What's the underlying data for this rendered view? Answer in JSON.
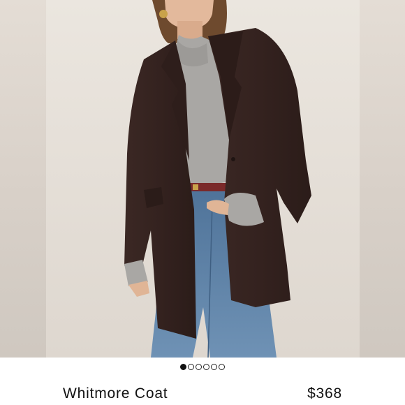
{
  "product": {
    "name": "Whitmore Coat",
    "price": "$368"
  },
  "gallery": {
    "image_count": 6,
    "active_index": 0
  },
  "colors": {
    "background": "#ffffff",
    "photo_backdrop": "#e7e1da",
    "coat": "#3a2622",
    "sweater": "#a8a6a3",
    "jeans": "#5a7fa6",
    "text": "#111111"
  }
}
